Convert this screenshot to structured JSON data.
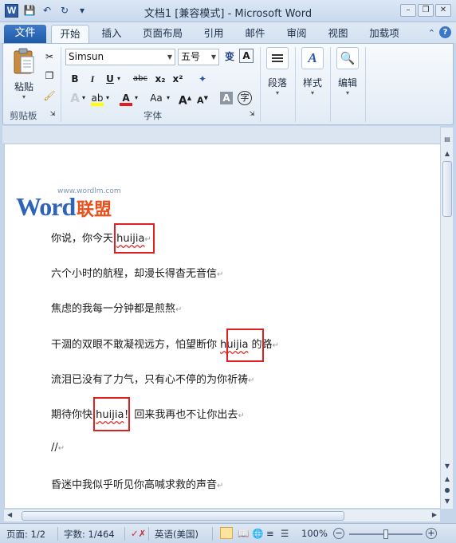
{
  "window": {
    "title": "文档1 [兼容模式] - Microsoft Word",
    "app_icon": "W",
    "controls": [
      "minimize-icon",
      "restore-icon",
      "close-icon"
    ]
  },
  "quick_access": [
    "save-icon",
    "undo-icon",
    "redo-icon",
    "customize-icon"
  ],
  "tabs": {
    "file": "文件",
    "items": [
      "开始",
      "插入",
      "页面布局",
      "引用",
      "邮件",
      "审阅",
      "视图",
      "加载项"
    ],
    "active_index": 0
  },
  "ribbon": {
    "clipboard": {
      "paste_label": "粘贴",
      "group_label": "剪贴板"
    },
    "font": {
      "font_name": "Simsun",
      "font_size": "五号",
      "wen_glyph": "变",
      "bold": "B",
      "italic": "I",
      "underline": "U",
      "strike": "abc",
      "subscript": "x₂",
      "superscript": "x²",
      "change_case": "Aa",
      "grow": "A",
      "shrink": "A",
      "char_border": "A",
      "enclose": "字",
      "group_label": "字体",
      "highlight_color": "#ffff00",
      "font_color": "#e02020"
    },
    "paragraph": {
      "label": "段落"
    },
    "styles": {
      "label": "样式"
    },
    "editing": {
      "label": "编辑"
    }
  },
  "document": {
    "logo": {
      "url": "www.wordlm.com",
      "word": "Word",
      "cn": "联盟"
    },
    "lines": [
      {
        "before": "你说，你今天 ",
        "highlight": "huijia",
        "after": ""
      },
      {
        "text": "六个小时的航程，却漫长得杳无音信"
      },
      {
        "text": "焦虑的我每一分钟都是煎熬"
      },
      {
        "before": "干涸的双眼不敢凝视远方，怕望断你 ",
        "highlight": "huijia",
        "after": " 的路"
      },
      {
        "text": "流泪已没有了力气，只有心不停的为你祈祷"
      },
      {
        "before": "期待你快 ",
        "highlight": "huijia",
        "after": "！回来我再也不让你出去"
      },
      {
        "text": "//"
      },
      {
        "text": "昏迷中我似乎听见你高喊求救的声音"
      }
    ],
    "paragraph_mark": "↵"
  },
  "status": {
    "page": "页面: 1/2",
    "words": "字数: 1/464",
    "language": "英语(美国)",
    "zoom": "100%",
    "zoom_level": 0.5
  }
}
